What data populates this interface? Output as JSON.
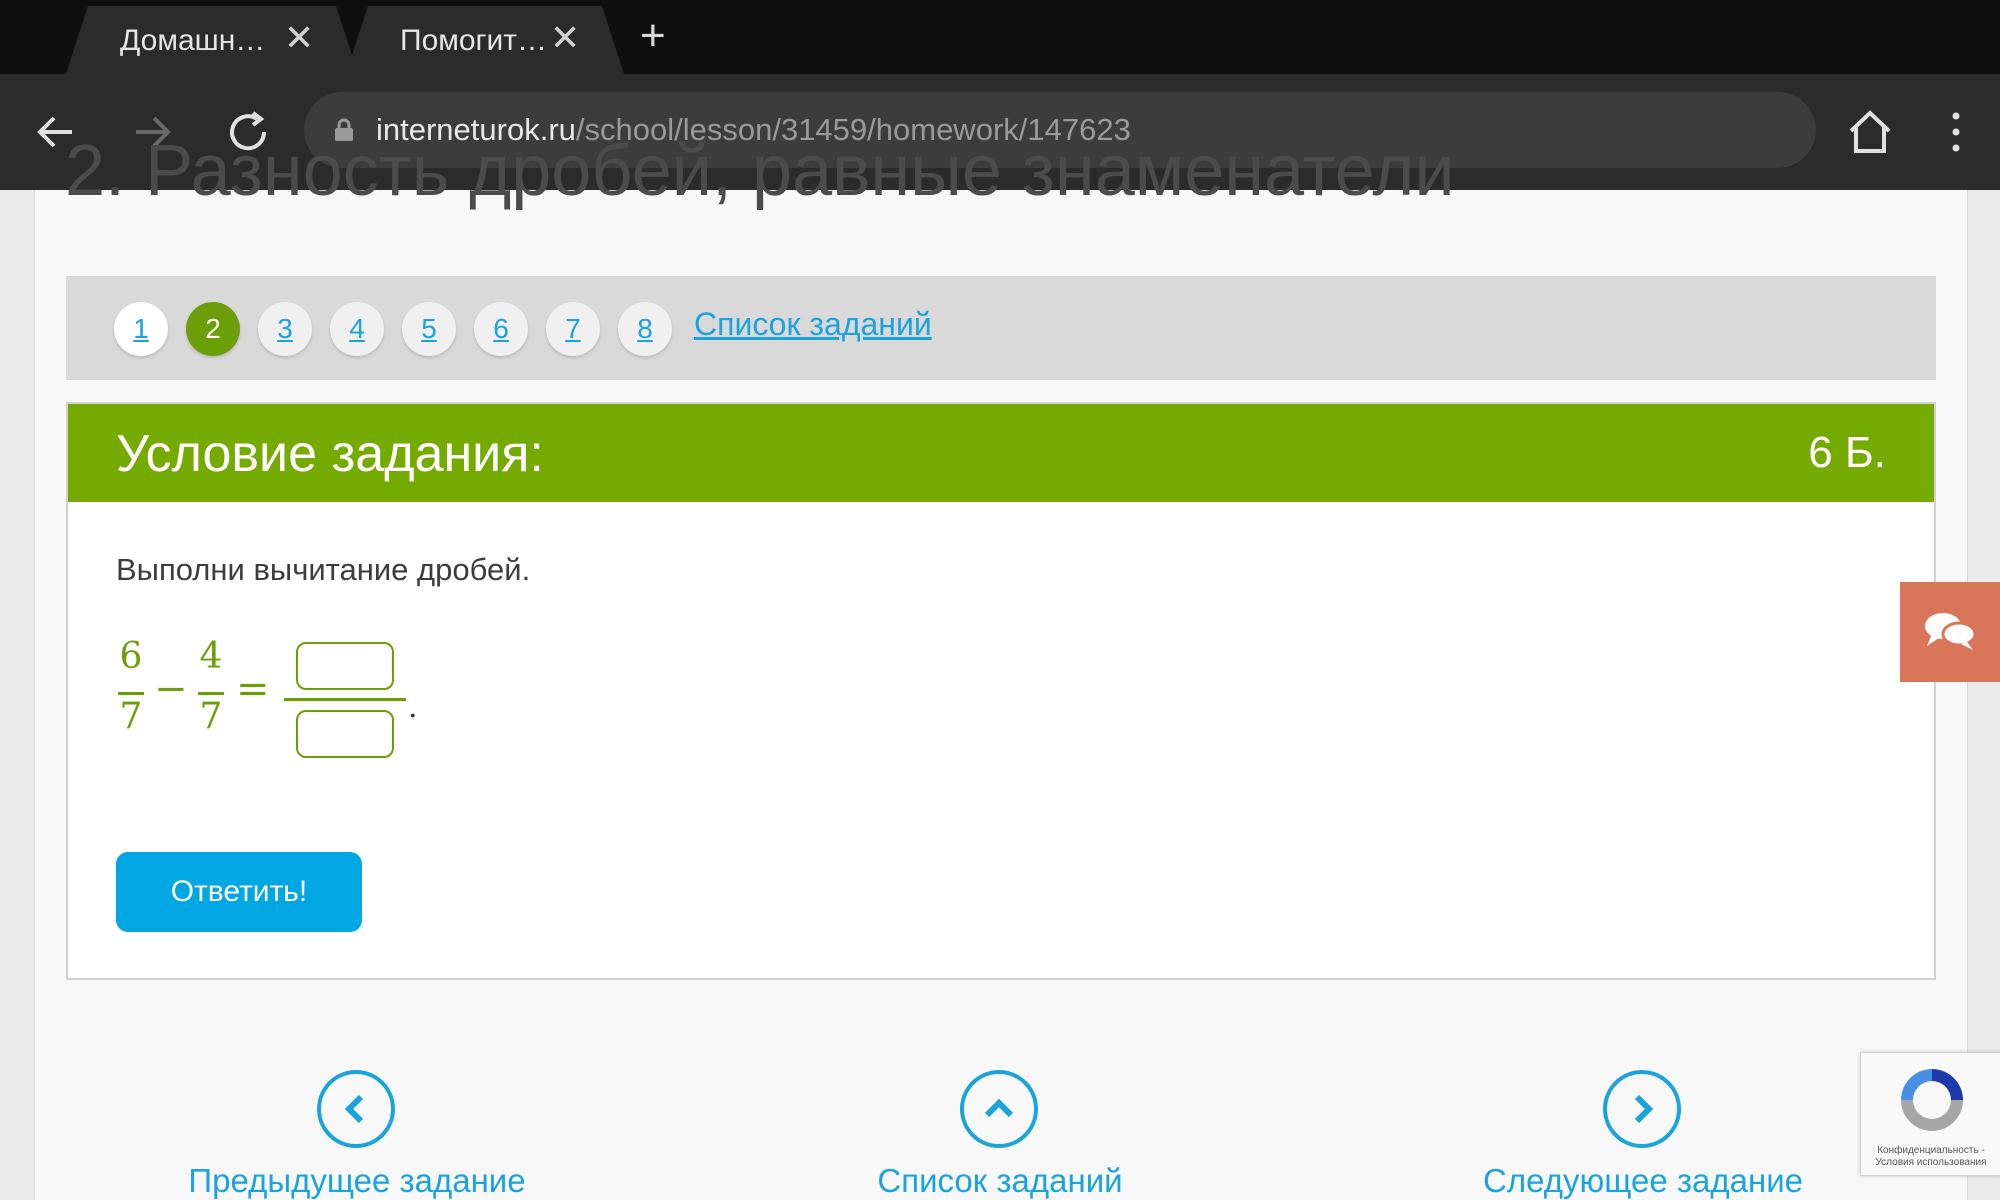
{
  "browser": {
    "tabs": [
      {
        "title": "Домашн…"
      },
      {
        "title": "Помогит…"
      }
    ],
    "url_domain": "interneturok.ru",
    "url_path": "/school/lesson/31459/homework/147623"
  },
  "page": {
    "heading_partial": "2. Разность дробей, равные знаменатели",
    "pager": {
      "items": [
        "1",
        "2",
        "3",
        "4",
        "5",
        "6",
        "7",
        "8"
      ],
      "active": "2",
      "list_link": "Список заданий"
    },
    "task": {
      "header_title": "Условие задания:",
      "points": "6 Б.",
      "instruction": "Выполни вычитание дробей.",
      "expression": {
        "a_num": "6",
        "a_den": "7",
        "minus": "−",
        "b_num": "4",
        "b_den": "7",
        "equals": "=",
        "period": "."
      },
      "answer_button": "Ответить!"
    },
    "bottom_nav": {
      "prev": "Предыдущее задание",
      "list": "Список заданий",
      "next": "Следующее задание"
    },
    "recaptcha_text": "Конфиденциальность - Условия использования"
  },
  "colors": {
    "accent_green": "#75ab00",
    "link_blue": "#1ba3dd",
    "button_blue": "#00a7e3",
    "chat_widget": "#d9765a"
  }
}
